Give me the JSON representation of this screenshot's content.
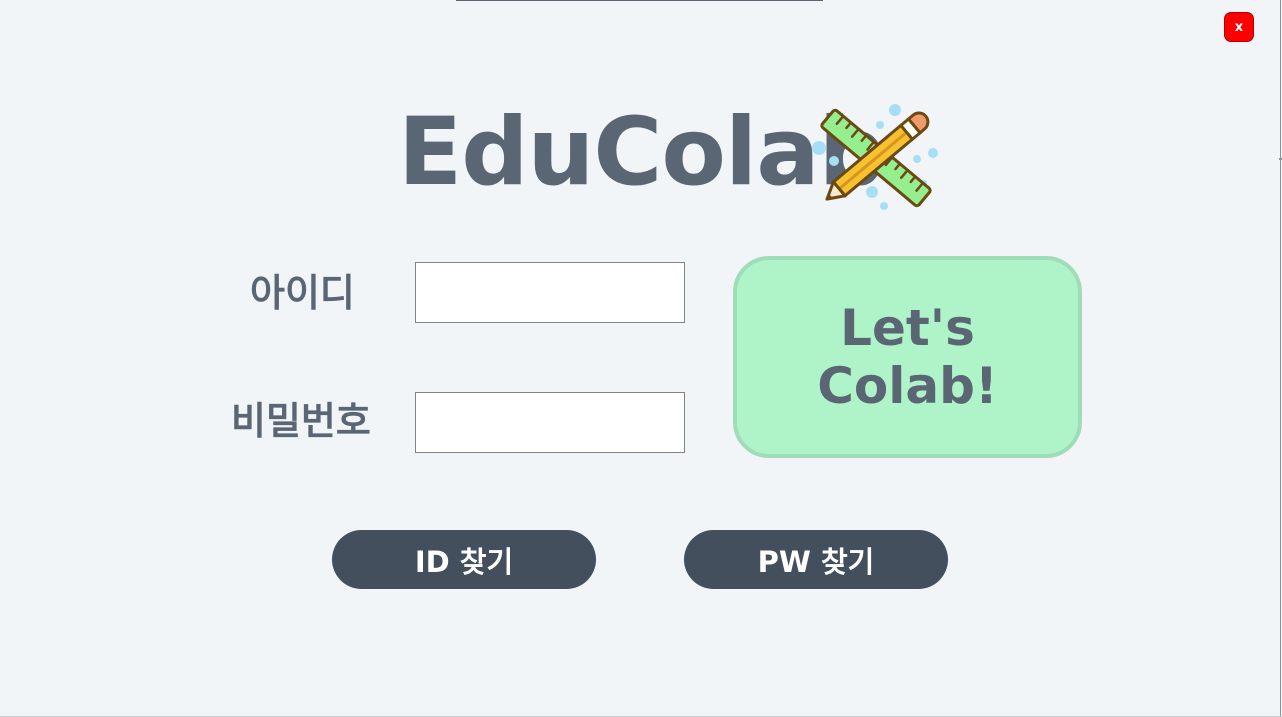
{
  "window": {
    "close_label": "x"
  },
  "logo": {
    "title": "EduColab",
    "icon": "pencil-ruler-icon"
  },
  "login": {
    "id_label": "아이디",
    "id_value": "",
    "pw_label": "비밀번호",
    "pw_value": "",
    "submit_line1": "Let's",
    "submit_line2": "Colab!"
  },
  "actions": {
    "find_id_label": "ID 찾기",
    "find_pw_label": "PW 찾기"
  },
  "colors": {
    "background": "#f1f5f7",
    "title_text": "#5a6674",
    "submit_fill": "#aff3c8",
    "submit_border": "#9fddb8",
    "action_button": "#434f5c",
    "close_button": "#ff0000"
  }
}
